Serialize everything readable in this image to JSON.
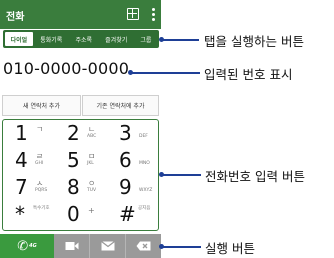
{
  "app": {
    "title": "전화"
  },
  "tabs": [
    {
      "label": "다이얼",
      "active": true
    },
    {
      "label": "통화기록",
      "active": false
    },
    {
      "label": "주소록",
      "active": false
    },
    {
      "label": "즐겨찾기",
      "active": false
    },
    {
      "label": "그룹",
      "active": false
    }
  ],
  "display": {
    "number": "010-0000-0000"
  },
  "contact_buttons": {
    "new": "새 연락처 추가",
    "existing": "기존 연락처에 추가"
  },
  "keypad": {
    "keys": [
      {
        "digit": "1",
        "sym": "ㄱ",
        "letters": ""
      },
      {
        "digit": "2",
        "sym": "ㄴ",
        "letters": "ABC"
      },
      {
        "digit": "3",
        "sym": "",
        "letters": "DEF"
      },
      {
        "digit": "4",
        "sym": "ㄹ",
        "letters": "GHI"
      },
      {
        "digit": "5",
        "sym": "ㅁ",
        "letters": "JKL"
      },
      {
        "digit": "6",
        "sym": "",
        "letters": "MNO"
      },
      {
        "digit": "7",
        "sym": "ㅅ",
        "letters": "PQRS"
      },
      {
        "digit": "8",
        "sym": "ㅇ",
        "letters": "TUV"
      },
      {
        "digit": "9",
        "sym": "",
        "letters": "WXYZ"
      },
      {
        "digit": "*",
        "sym": "",
        "letters": "특수기호"
      },
      {
        "digit": "0",
        "sym": "+",
        "letters": ""
      },
      {
        "digit": "#",
        "sym": "",
        "letters": "공지음"
      }
    ]
  },
  "actions": {
    "call_text": "4G"
  },
  "annotations": {
    "tabs": "탭을 실행하는 버튼",
    "number": "입력된 번호 표시",
    "keypad": "전화번호 입력 버튼",
    "actions": "실행 버튼"
  },
  "colors": {
    "primary_green": "#3a7d3d",
    "call_green": "#3a9a3e",
    "lead_blue": "#1e3f96"
  }
}
